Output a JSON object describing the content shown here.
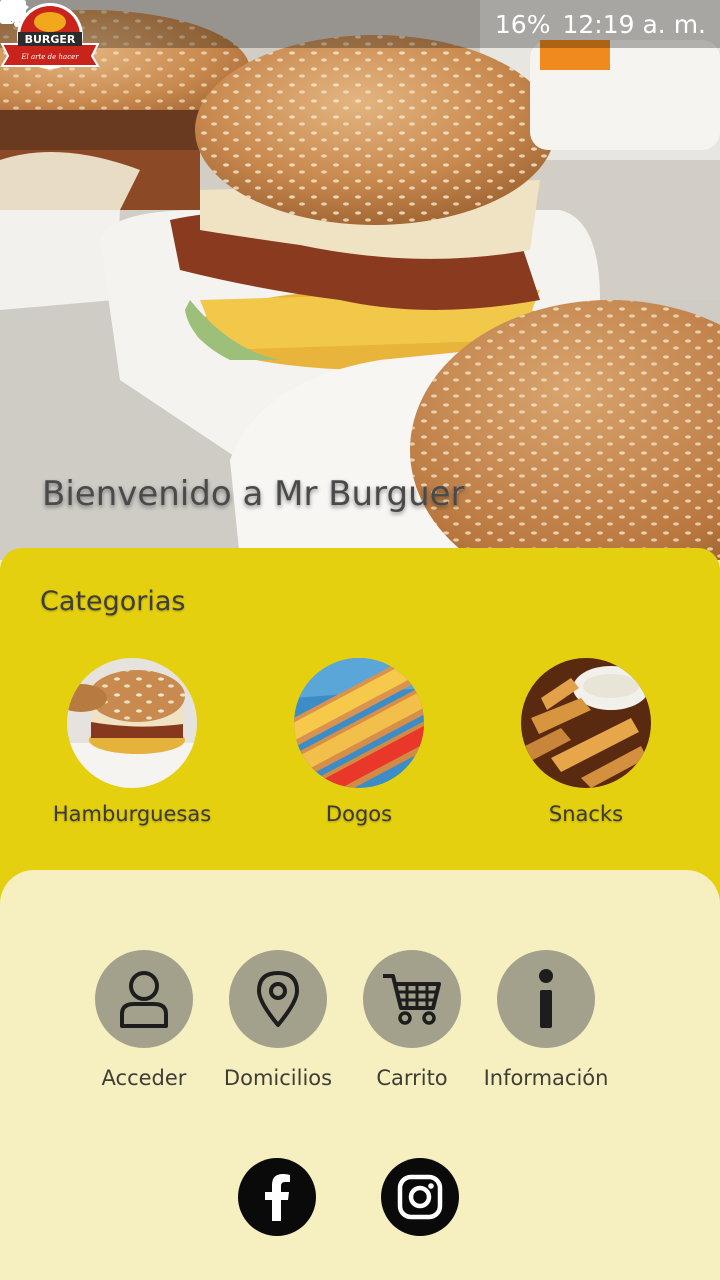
{
  "status_bar": {
    "battery": "16%",
    "time": "12:19 a. m.",
    "icons_left": [
      "image-icon",
      "cloud-icon",
      "facebook-icon",
      "dot-icon"
    ],
    "icons_right": [
      "mute-icon",
      "wifi-icon",
      "signal-icon",
      "battery-icon"
    ]
  },
  "hero": {
    "welcome_text": "Bienvenido a Mr Burguer",
    "logo_icon": "mr-burger-logo",
    "logo_lettering": "Mr. BURGER El arte de hacer hamburguesas"
  },
  "categories": {
    "title": "Categorias",
    "items": [
      {
        "label": "Hamburguesas",
        "icon": "burger-photo"
      },
      {
        "label": "Dogos",
        "icon": "hotdog-photo"
      },
      {
        "label": "Snacks",
        "icon": "fries-photo"
      }
    ]
  },
  "menu": {
    "items": [
      {
        "label": "Acceder",
        "icon": "user-icon"
      },
      {
        "label": "Domicilios",
        "icon": "location-pin-icon"
      },
      {
        "label": "Carrito",
        "icon": "cart-icon"
      },
      {
        "label": "Información",
        "icon": "info-icon"
      }
    ]
  },
  "social": [
    "facebook-icon",
    "instagram-icon"
  ],
  "colors": {
    "categories_bg": "#e5d010",
    "panel_bg": "#f6efc0",
    "menu_circle": "#a3a18c",
    "text": "#3f3e36"
  }
}
